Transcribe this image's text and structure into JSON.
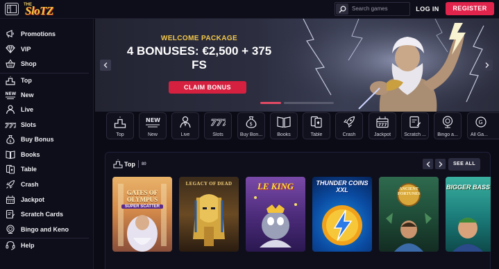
{
  "header": {
    "logo_small": "THE",
    "logo_main": "SloTZ",
    "search_placeholder": "Search games",
    "login_label": "LOG IN",
    "register_label": "REGISTER"
  },
  "sidebar": {
    "items": [
      {
        "label": "Promotions",
        "icon": "megaphone-icon"
      },
      {
        "label": "VIP",
        "icon": "diamond-icon"
      },
      {
        "label": "Shop",
        "icon": "basket-icon"
      },
      {
        "label": "Top",
        "icon": "podium-icon"
      },
      {
        "label": "New",
        "icon": "new-badge-icon"
      },
      {
        "label": "Live",
        "icon": "dealer-icon"
      },
      {
        "label": "Slots",
        "icon": "slot-777-icon"
      },
      {
        "label": "Buy Bonus",
        "icon": "money-bag-icon"
      },
      {
        "label": "Books",
        "icon": "book-icon"
      },
      {
        "label": "Table",
        "icon": "cards-icon"
      },
      {
        "label": "Crash",
        "icon": "rocket-icon"
      },
      {
        "label": "Jackpot",
        "icon": "jackpot-icon"
      },
      {
        "label": "Scratch Cards",
        "icon": "scratch-card-icon"
      },
      {
        "label": "Bingo and Keno",
        "icon": "bingo-ball-icon"
      },
      {
        "label": "Help",
        "icon": "headset-icon"
      }
    ]
  },
  "banner": {
    "subtitle": "WELCOME PACKAGE",
    "title_line1": "4 BONUSES: €2,500 + 375",
    "title_line2": "FS",
    "cta_label": "CLAIM BONUS"
  },
  "categories": [
    {
      "label": "Top",
      "icon": "podium-icon"
    },
    {
      "label": "New",
      "icon": "new-badge-icon"
    },
    {
      "label": "Live",
      "icon": "dealer-icon"
    },
    {
      "label": "Slots",
      "icon": "slot-777-icon"
    },
    {
      "label": "Buy Bon...",
      "icon": "money-bag-icon"
    },
    {
      "label": "Books",
      "icon": "book-icon"
    },
    {
      "label": "Table",
      "icon": "cards-icon"
    },
    {
      "label": "Crash",
      "icon": "rocket-icon"
    },
    {
      "label": "Jackpot",
      "icon": "jackpot-icon"
    },
    {
      "label": "Scratch ...",
      "icon": "scratch-card-icon"
    },
    {
      "label": "Bingo a...",
      "icon": "bingo-ball-icon"
    },
    {
      "label": "All Ga...",
      "icon": "all-games-icon"
    }
  ],
  "top_section": {
    "title": "Top",
    "count": "80",
    "see_all_label": "SEE ALL"
  },
  "games": [
    {
      "title": "GATES OF OLYMPUS",
      "subtitle": "SUPER SCATTER"
    },
    {
      "title": "LEGACY OF DEAD",
      "subtitle": ""
    },
    {
      "title": "LE KING",
      "subtitle": ""
    },
    {
      "title": "THUNDER COINS XXL",
      "subtitle": ""
    },
    {
      "title": "ANCIENT FORTUNES",
      "subtitle": ""
    },
    {
      "title": "BIGGER BASS",
      "subtitle": ""
    }
  ],
  "colors": {
    "accent_red": "#e0244b",
    "gold": "#f4c84a",
    "background": "#0b0b16"
  }
}
